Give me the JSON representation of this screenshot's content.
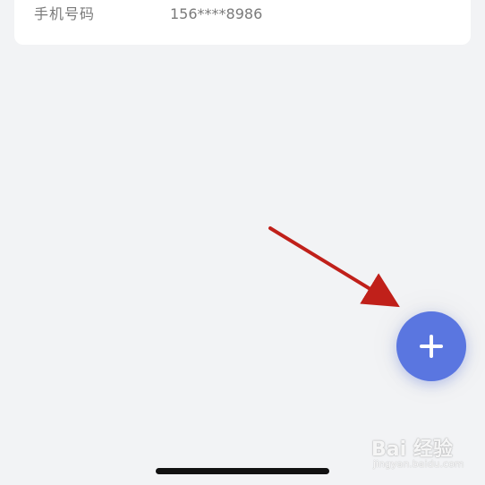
{
  "profile": {
    "phone_label": "手机号码",
    "phone_value": "156****8986"
  },
  "fab": {
    "icon": "plus-icon",
    "color": "#5a76e0"
  },
  "annotation": {
    "arrow_color": "#c0201a"
  },
  "watermark": {
    "brand": "Bai 经验",
    "url": "jingyan.baidu.com"
  },
  "colors": {
    "background": "#f2f3f5",
    "card": "#ffffff",
    "text_secondary": "#7a7a7a"
  }
}
